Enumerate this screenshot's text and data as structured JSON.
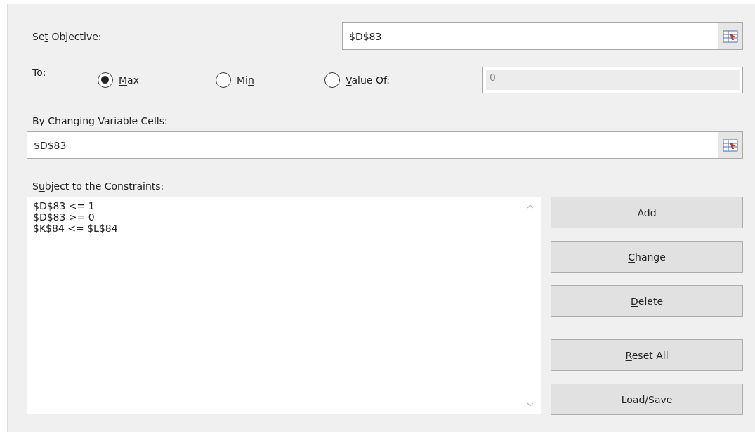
{
  "objective": {
    "label": {
      "pre": "Se",
      "key": "t",
      "post": " Objective:"
    },
    "value": "$D$83"
  },
  "to": {
    "label": "To:",
    "options": [
      {
        "label": {
          "key": "M",
          "post": "ax"
        },
        "selected": true
      },
      {
        "label": {
          "pre": "Mi",
          "key": "n"
        },
        "selected": false
      },
      {
        "label": {
          "key": "V",
          "post": "alue Of:"
        },
        "selected": false
      }
    ],
    "value_of": {
      "value": "0",
      "disabled": true
    }
  },
  "variable_cells": {
    "label": {
      "key": "B",
      "post": "y Changing Variable Cells:"
    },
    "value": "$D$83"
  },
  "constraints": {
    "label": {
      "pre": "S",
      "key": "u",
      "post": "bject to the Constraints:"
    },
    "items": [
      "$D$83 <= 1",
      "$D$83 >= 0",
      "$K$84 <= $L$84"
    ]
  },
  "buttons": [
    {
      "label": {
        "key": "A",
        "post": "dd"
      }
    },
    {
      "label": {
        "key": "C",
        "post": "hange"
      }
    },
    {
      "label": {
        "key": "D",
        "post": "elete"
      }
    },
    {
      "label": {
        "key": "R",
        "post": "eset All"
      }
    },
    {
      "label": {
        "key": "L",
        "post": "oad/Save"
      }
    }
  ]
}
